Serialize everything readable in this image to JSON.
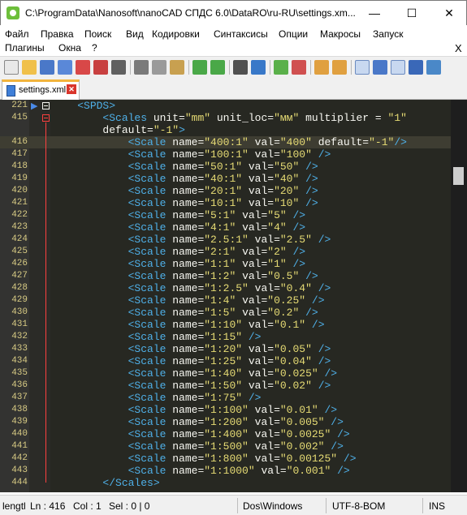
{
  "window": {
    "title": "C:\\ProgramData\\Nanosoft\\nanoCAD СПДС 6.0\\DataRO\\ru-RU\\settings.xm...",
    "minimize": "—",
    "maximize": "☐",
    "close": "✕"
  },
  "menu": {
    "items": [
      "Файл",
      "Правка",
      "Поиск",
      "Вид",
      "Кодировки",
      "Синтаксисы",
      "Опции",
      "Макросы",
      "Запуск",
      "Плагины",
      "Окна",
      "?"
    ],
    "close_doc": "X"
  },
  "tab": {
    "label": "settings.xml",
    "close": "✕"
  },
  "editor": {
    "lines": [
      {
        "num": "221",
        "indent": "    ",
        "tokens": [
          {
            "t": "tag",
            "v": "<SPDS>"
          }
        ]
      },
      {
        "num": "415",
        "indent": "        ",
        "tokens": [
          {
            "t": "tag",
            "v": "<Scales"
          },
          {
            "t": "attr",
            "v": " unit="
          },
          {
            "t": "val",
            "v": "\"mm\""
          },
          {
            "t": "attr",
            "v": " unit_loc="
          },
          {
            "t": "val",
            "v": "\"мм\""
          },
          {
            "t": "attr",
            "v": " multiplier = "
          },
          {
            "t": "val",
            "v": "\"1\""
          }
        ]
      },
      {
        "num": "",
        "indent": "        ",
        "tokens": [
          {
            "t": "attr",
            "v": "default="
          },
          {
            "t": "val",
            "v": "\"-1\""
          },
          {
            "t": "tag",
            "v": ">"
          }
        ]
      },
      {
        "num": "416",
        "indent": "            ",
        "tokens": [
          {
            "t": "tag",
            "v": "<Scale"
          },
          {
            "t": "attr",
            "v": " name="
          },
          {
            "t": "val",
            "v": "\"400:1\""
          },
          {
            "t": "attr",
            "v": " val="
          },
          {
            "t": "val",
            "v": "\"400\""
          },
          {
            "t": "attr",
            "v": " default="
          },
          {
            "t": "val",
            "v": "\"-1\""
          },
          {
            "t": "tag",
            "v": "/>"
          }
        ]
      },
      {
        "num": "417",
        "indent": "            ",
        "tokens": [
          {
            "t": "tag",
            "v": "<Scale"
          },
          {
            "t": "attr",
            "v": " name="
          },
          {
            "t": "val",
            "v": "\"100:1\""
          },
          {
            "t": "attr",
            "v": " val="
          },
          {
            "t": "val",
            "v": "\"100\""
          },
          {
            "t": "tag",
            "v": " />"
          }
        ]
      },
      {
        "num": "418",
        "indent": "            ",
        "tokens": [
          {
            "t": "tag",
            "v": "<Scale"
          },
          {
            "t": "attr",
            "v": " name="
          },
          {
            "t": "val",
            "v": "\"50:1\""
          },
          {
            "t": "attr",
            "v": " val="
          },
          {
            "t": "val",
            "v": "\"50\""
          },
          {
            "t": "tag",
            "v": " />"
          }
        ]
      },
      {
        "num": "419",
        "indent": "            ",
        "tokens": [
          {
            "t": "tag",
            "v": "<Scale"
          },
          {
            "t": "attr",
            "v": " name="
          },
          {
            "t": "val",
            "v": "\"40:1\""
          },
          {
            "t": "attr",
            "v": " val="
          },
          {
            "t": "val",
            "v": "\"40\""
          },
          {
            "t": "tag",
            "v": " />"
          }
        ]
      },
      {
        "num": "420",
        "indent": "            ",
        "tokens": [
          {
            "t": "tag",
            "v": "<Scale"
          },
          {
            "t": "attr",
            "v": " name="
          },
          {
            "t": "val",
            "v": "\"20:1\""
          },
          {
            "t": "attr",
            "v": " val="
          },
          {
            "t": "val",
            "v": "\"20\""
          },
          {
            "t": "tag",
            "v": " />"
          }
        ]
      },
      {
        "num": "421",
        "indent": "            ",
        "tokens": [
          {
            "t": "tag",
            "v": "<Scale"
          },
          {
            "t": "attr",
            "v": " name="
          },
          {
            "t": "val",
            "v": "\"10:1\""
          },
          {
            "t": "attr",
            "v": " val="
          },
          {
            "t": "val",
            "v": "\"10\""
          },
          {
            "t": "tag",
            "v": " />"
          }
        ]
      },
      {
        "num": "422",
        "indent": "            ",
        "tokens": [
          {
            "t": "tag",
            "v": "<Scale"
          },
          {
            "t": "attr",
            "v": " name="
          },
          {
            "t": "val",
            "v": "\"5:1\""
          },
          {
            "t": "attr",
            "v": " val="
          },
          {
            "t": "val",
            "v": "\"5\""
          },
          {
            "t": "tag",
            "v": " />"
          }
        ]
      },
      {
        "num": "423",
        "indent": "            ",
        "tokens": [
          {
            "t": "tag",
            "v": "<Scale"
          },
          {
            "t": "attr",
            "v": " name="
          },
          {
            "t": "val",
            "v": "\"4:1\""
          },
          {
            "t": "attr",
            "v": " val="
          },
          {
            "t": "val",
            "v": "\"4\""
          },
          {
            "t": "tag",
            "v": " />"
          }
        ]
      },
      {
        "num": "424",
        "indent": "            ",
        "tokens": [
          {
            "t": "tag",
            "v": "<Scale"
          },
          {
            "t": "attr",
            "v": " name="
          },
          {
            "t": "val",
            "v": "\"2.5:1\""
          },
          {
            "t": "attr",
            "v": " val="
          },
          {
            "t": "val",
            "v": "\"2.5\""
          },
          {
            "t": "tag",
            "v": " />"
          }
        ]
      },
      {
        "num": "425",
        "indent": "            ",
        "tokens": [
          {
            "t": "tag",
            "v": "<Scale"
          },
          {
            "t": "attr",
            "v": " name="
          },
          {
            "t": "val",
            "v": "\"2:1\""
          },
          {
            "t": "attr",
            "v": " val="
          },
          {
            "t": "val",
            "v": "\"2\""
          },
          {
            "t": "tag",
            "v": " />"
          }
        ]
      },
      {
        "num": "426",
        "indent": "            ",
        "tokens": [
          {
            "t": "tag",
            "v": "<Scale"
          },
          {
            "t": "attr",
            "v": " name="
          },
          {
            "t": "val",
            "v": "\"1:1\""
          },
          {
            "t": "attr",
            "v": " val="
          },
          {
            "t": "val",
            "v": "\"1\""
          },
          {
            "t": "tag",
            "v": " />"
          }
        ]
      },
      {
        "num": "427",
        "indent": "            ",
        "tokens": [
          {
            "t": "tag",
            "v": "<Scale"
          },
          {
            "t": "attr",
            "v": " name="
          },
          {
            "t": "val",
            "v": "\"1:2\""
          },
          {
            "t": "attr",
            "v": " val="
          },
          {
            "t": "val",
            "v": "\"0.5\""
          },
          {
            "t": "tag",
            "v": " />"
          }
        ]
      },
      {
        "num": "428",
        "indent": "            ",
        "tokens": [
          {
            "t": "tag",
            "v": "<Scale"
          },
          {
            "t": "attr",
            "v": " name="
          },
          {
            "t": "val",
            "v": "\"1:2.5\""
          },
          {
            "t": "attr",
            "v": " val="
          },
          {
            "t": "val",
            "v": "\"0.4\""
          },
          {
            "t": "tag",
            "v": " />"
          }
        ]
      },
      {
        "num": "429",
        "indent": "            ",
        "tokens": [
          {
            "t": "tag",
            "v": "<Scale"
          },
          {
            "t": "attr",
            "v": " name="
          },
          {
            "t": "val",
            "v": "\"1:4\""
          },
          {
            "t": "attr",
            "v": " val="
          },
          {
            "t": "val",
            "v": "\"0.25\""
          },
          {
            "t": "tag",
            "v": " />"
          }
        ]
      },
      {
        "num": "430",
        "indent": "            ",
        "tokens": [
          {
            "t": "tag",
            "v": "<Scale"
          },
          {
            "t": "attr",
            "v": " name="
          },
          {
            "t": "val",
            "v": "\"1:5\""
          },
          {
            "t": "attr",
            "v": " val="
          },
          {
            "t": "val",
            "v": "\"0.2\""
          },
          {
            "t": "tag",
            "v": " />"
          }
        ]
      },
      {
        "num": "431",
        "indent": "            ",
        "tokens": [
          {
            "t": "tag",
            "v": "<Scale"
          },
          {
            "t": "attr",
            "v": " name="
          },
          {
            "t": "val",
            "v": "\"1:10\""
          },
          {
            "t": "attr",
            "v": " val="
          },
          {
            "t": "val",
            "v": "\"0.1\""
          },
          {
            "t": "tag",
            "v": " />"
          }
        ]
      },
      {
        "num": "432",
        "indent": "            ",
        "tokens": [
          {
            "t": "tag",
            "v": "<Scale"
          },
          {
            "t": "attr",
            "v": " name="
          },
          {
            "t": "val",
            "v": "\"1:15\""
          },
          {
            "t": "tag",
            "v": " />"
          }
        ]
      },
      {
        "num": "433",
        "indent": "            ",
        "tokens": [
          {
            "t": "tag",
            "v": "<Scale"
          },
          {
            "t": "attr",
            "v": " name="
          },
          {
            "t": "val",
            "v": "\"1:20\""
          },
          {
            "t": "attr",
            "v": " val="
          },
          {
            "t": "val",
            "v": "\"0.05\""
          },
          {
            "t": "tag",
            "v": " />"
          }
        ]
      },
      {
        "num": "434",
        "indent": "            ",
        "tokens": [
          {
            "t": "tag",
            "v": "<Scale"
          },
          {
            "t": "attr",
            "v": " name="
          },
          {
            "t": "val",
            "v": "\"1:25\""
          },
          {
            "t": "attr",
            "v": " val="
          },
          {
            "t": "val",
            "v": "\"0.04\""
          },
          {
            "t": "tag",
            "v": " />"
          }
        ]
      },
      {
        "num": "435",
        "indent": "            ",
        "tokens": [
          {
            "t": "tag",
            "v": "<Scale"
          },
          {
            "t": "attr",
            "v": " name="
          },
          {
            "t": "val",
            "v": "\"1:40\""
          },
          {
            "t": "attr",
            "v": " val="
          },
          {
            "t": "val",
            "v": "\"0.025\""
          },
          {
            "t": "tag",
            "v": " />"
          }
        ]
      },
      {
        "num": "436",
        "indent": "            ",
        "tokens": [
          {
            "t": "tag",
            "v": "<Scale"
          },
          {
            "t": "attr",
            "v": " name="
          },
          {
            "t": "val",
            "v": "\"1:50\""
          },
          {
            "t": "attr",
            "v": " val="
          },
          {
            "t": "val",
            "v": "\"0.02\""
          },
          {
            "t": "tag",
            "v": " />"
          }
        ]
      },
      {
        "num": "437",
        "indent": "            ",
        "tokens": [
          {
            "t": "tag",
            "v": "<Scale"
          },
          {
            "t": "attr",
            "v": " name="
          },
          {
            "t": "val",
            "v": "\"1:75\""
          },
          {
            "t": "tag",
            "v": " />"
          }
        ]
      },
      {
        "num": "438",
        "indent": "            ",
        "tokens": [
          {
            "t": "tag",
            "v": "<Scale"
          },
          {
            "t": "attr",
            "v": " name="
          },
          {
            "t": "val",
            "v": "\"1:100\""
          },
          {
            "t": "attr",
            "v": " val="
          },
          {
            "t": "val",
            "v": "\"0.01\""
          },
          {
            "t": "tag",
            "v": " />"
          }
        ]
      },
      {
        "num": "439",
        "indent": "            ",
        "tokens": [
          {
            "t": "tag",
            "v": "<Scale"
          },
          {
            "t": "attr",
            "v": " name="
          },
          {
            "t": "val",
            "v": "\"1:200\""
          },
          {
            "t": "attr",
            "v": " val="
          },
          {
            "t": "val",
            "v": "\"0.005\""
          },
          {
            "t": "tag",
            "v": " />"
          }
        ]
      },
      {
        "num": "440",
        "indent": "            ",
        "tokens": [
          {
            "t": "tag",
            "v": "<Scale"
          },
          {
            "t": "attr",
            "v": " name="
          },
          {
            "t": "val",
            "v": "\"1:400\""
          },
          {
            "t": "attr",
            "v": " val="
          },
          {
            "t": "val",
            "v": "\"0.0025\""
          },
          {
            "t": "tag",
            "v": " />"
          }
        ]
      },
      {
        "num": "441",
        "indent": "            ",
        "tokens": [
          {
            "t": "tag",
            "v": "<Scale"
          },
          {
            "t": "attr",
            "v": " name="
          },
          {
            "t": "val",
            "v": "\"1:500\""
          },
          {
            "t": "attr",
            "v": " val="
          },
          {
            "t": "val",
            "v": "\"0.002\""
          },
          {
            "t": "tag",
            "v": " />"
          }
        ]
      },
      {
        "num": "442",
        "indent": "            ",
        "tokens": [
          {
            "t": "tag",
            "v": "<Scale"
          },
          {
            "t": "attr",
            "v": " name="
          },
          {
            "t": "val",
            "v": "\"1:800\""
          },
          {
            "t": "attr",
            "v": " val="
          },
          {
            "t": "val",
            "v": "\"0.00125\""
          },
          {
            "t": "tag",
            "v": " />"
          }
        ]
      },
      {
        "num": "443",
        "indent": "            ",
        "tokens": [
          {
            "t": "tag",
            "v": "<Scale"
          },
          {
            "t": "attr",
            "v": " name="
          },
          {
            "t": "val",
            "v": "\"1:1000\""
          },
          {
            "t": "attr",
            "v": " val="
          },
          {
            "t": "val",
            "v": "\"0.001\""
          },
          {
            "t": "tag",
            "v": " />"
          }
        ]
      },
      {
        "num": "444",
        "indent": "        ",
        "tokens": [
          {
            "t": "tag",
            "v": "</Scales>"
          }
        ]
      }
    ]
  },
  "status": {
    "length": "lengtl",
    "ln": "Ln : 416",
    "col": "Col : 1",
    "sel": "Sel : 0 | 0",
    "eol": "Dos\\Windows",
    "encoding": "UTF-8-BOM",
    "mode": "INS"
  },
  "colors": {
    "editor_bg": "#272822",
    "tag": "#4fb0e8",
    "value": "#e6db74",
    "line_number": "#d8cb84",
    "current_line": "#3e3d32",
    "tab_accent": "#f2b43c"
  }
}
